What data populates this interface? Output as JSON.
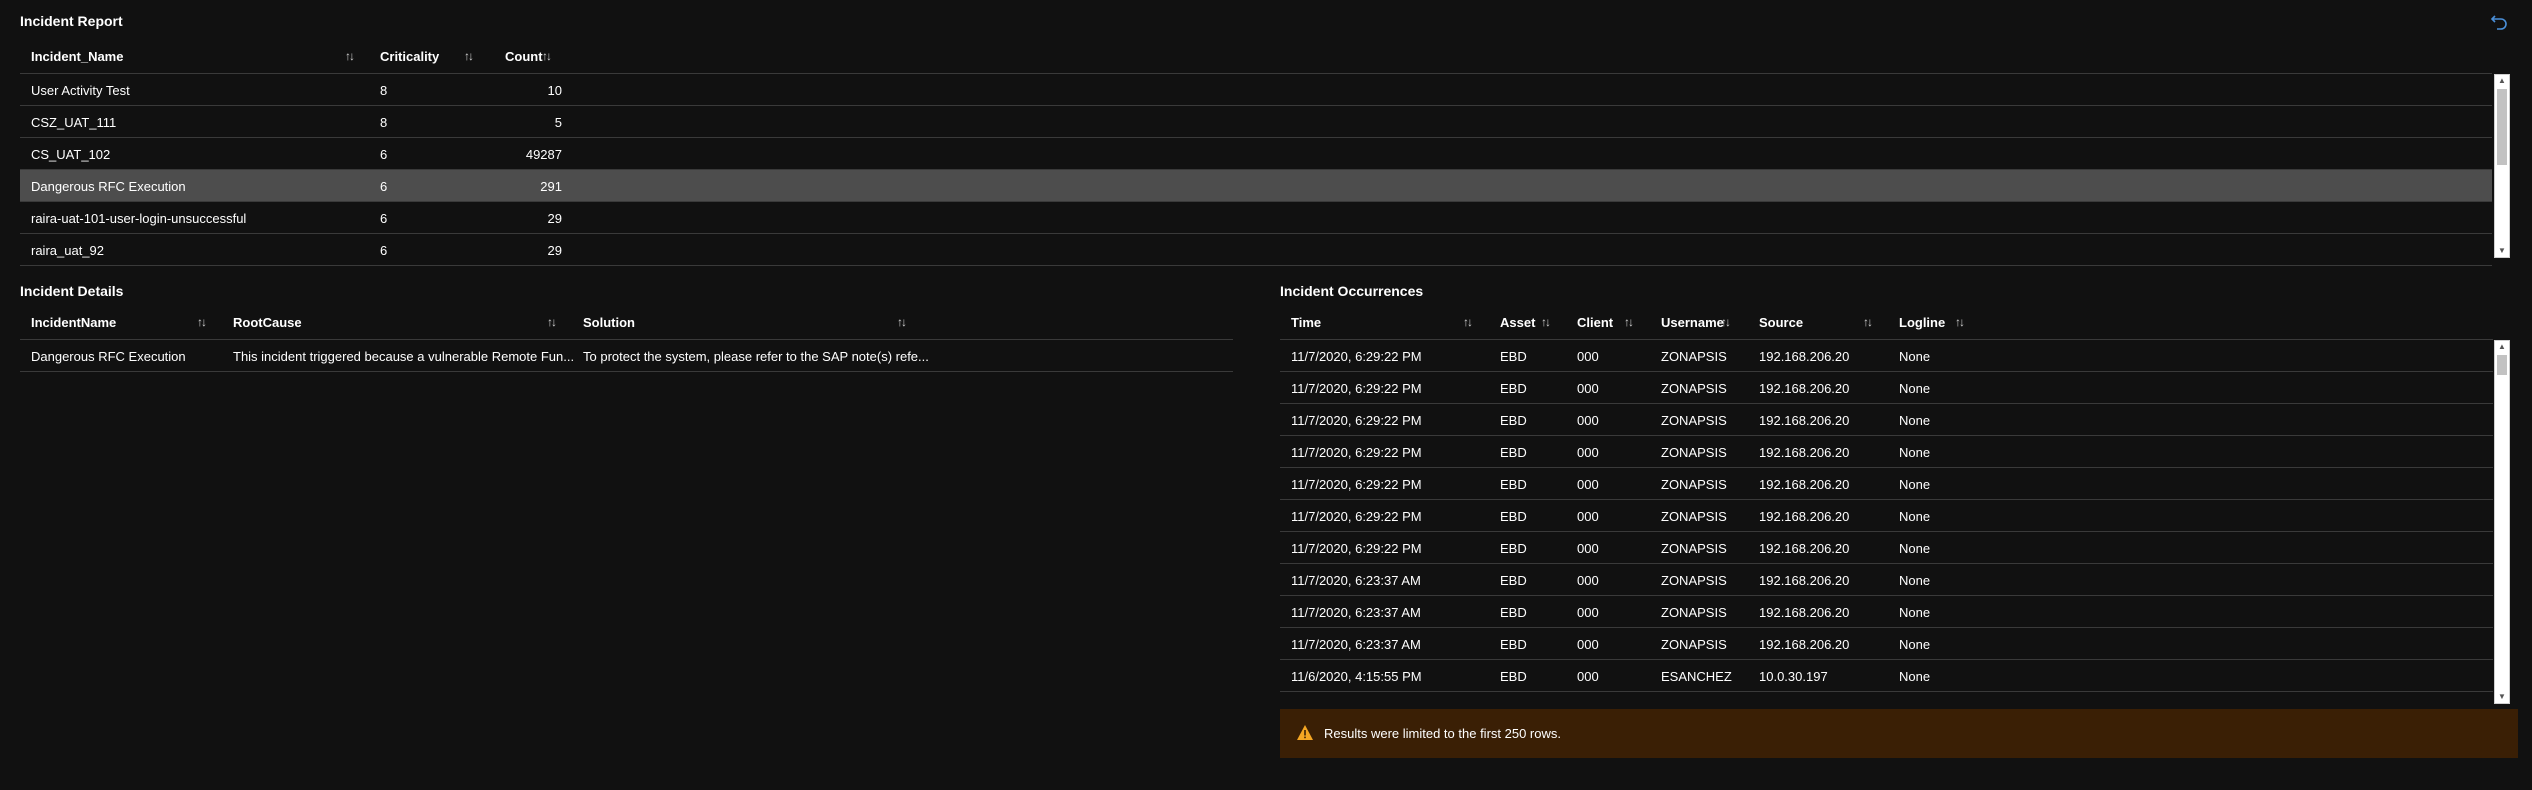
{
  "incident_report": {
    "title": "Incident Report",
    "columns": [
      "Incident_Name",
      "Criticality",
      "Count"
    ],
    "rows": [
      {
        "name": "User Activity Test",
        "criticality": "8",
        "count": "10"
      },
      {
        "name": "CSZ_UAT_111",
        "criticality": "8",
        "count": "5"
      },
      {
        "name": "CS_UAT_102",
        "criticality": "6",
        "count": "49287"
      },
      {
        "name": "Dangerous RFC Execution",
        "criticality": "6",
        "count": "291"
      },
      {
        "name": "raira-uat-101-user-login-unsuccessful",
        "criticality": "6",
        "count": "29"
      },
      {
        "name": "raira_uat_92",
        "criticality": "6",
        "count": "29"
      }
    ],
    "selected_row": 3
  },
  "incident_details": {
    "title": "Incident Details",
    "columns": [
      "IncidentName",
      "RootCause",
      "Solution"
    ],
    "rows": [
      {
        "name": "Dangerous RFC Execution",
        "root_cause": "This incident triggered because a vulnerable Remote Fun...",
        "solution": "To protect the system, please refer to the SAP note(s) refe..."
      }
    ]
  },
  "incident_occurrences": {
    "title": "Incident Occurrences",
    "columns": [
      "Time",
      "Asset",
      "Client",
      "Username",
      "Source",
      "Logline"
    ],
    "rows": [
      {
        "time": "11/7/2020, 6:29:22 PM",
        "asset": "EBD",
        "client": "000",
        "username": "ZONAPSIS",
        "source": "192.168.206.20",
        "logline": "None"
      },
      {
        "time": "11/7/2020, 6:29:22 PM",
        "asset": "EBD",
        "client": "000",
        "username": "ZONAPSIS",
        "source": "192.168.206.20",
        "logline": "None"
      },
      {
        "time": "11/7/2020, 6:29:22 PM",
        "asset": "EBD",
        "client": "000",
        "username": "ZONAPSIS",
        "source": "192.168.206.20",
        "logline": "None"
      },
      {
        "time": "11/7/2020, 6:29:22 PM",
        "asset": "EBD",
        "client": "000",
        "username": "ZONAPSIS",
        "source": "192.168.206.20",
        "logline": "None"
      },
      {
        "time": "11/7/2020, 6:29:22 PM",
        "asset": "EBD",
        "client": "000",
        "username": "ZONAPSIS",
        "source": "192.168.206.20",
        "logline": "None"
      },
      {
        "time": "11/7/2020, 6:29:22 PM",
        "asset": "EBD",
        "client": "000",
        "username": "ZONAPSIS",
        "source": "192.168.206.20",
        "logline": "None"
      },
      {
        "time": "11/7/2020, 6:29:22 PM",
        "asset": "EBD",
        "client": "000",
        "username": "ZONAPSIS",
        "source": "192.168.206.20",
        "logline": "None"
      },
      {
        "time": "11/7/2020, 6:23:37 AM",
        "asset": "EBD",
        "client": "000",
        "username": "ZONAPSIS",
        "source": "192.168.206.20",
        "logline": "None"
      },
      {
        "time": "11/7/2020, 6:23:37 AM",
        "asset": "EBD",
        "client": "000",
        "username": "ZONAPSIS",
        "source": "192.168.206.20",
        "logline": "None"
      },
      {
        "time": "11/7/2020, 6:23:37 AM",
        "asset": "EBD",
        "client": "000",
        "username": "ZONAPSIS",
        "source": "192.168.206.20",
        "logline": "None"
      },
      {
        "time": "11/6/2020, 4:15:55 PM",
        "asset": "EBD",
        "client": "000",
        "username": "ESANCHEZ",
        "source": "10.0.30.197",
        "logline": "None"
      }
    ]
  },
  "banner": {
    "message": "Results were limited to the first 250 rows.",
    "icon": "warning-icon",
    "color": "#3a1f05",
    "icon_color": "#f5a623"
  },
  "icons": {
    "undo": "undo-icon",
    "sort": "sort-icon",
    "sort_glyph": "↑↓"
  },
  "colors": {
    "background": "#111111",
    "selected_row": "#4d4d4d",
    "undo_icon": "#4a8fd9"
  }
}
